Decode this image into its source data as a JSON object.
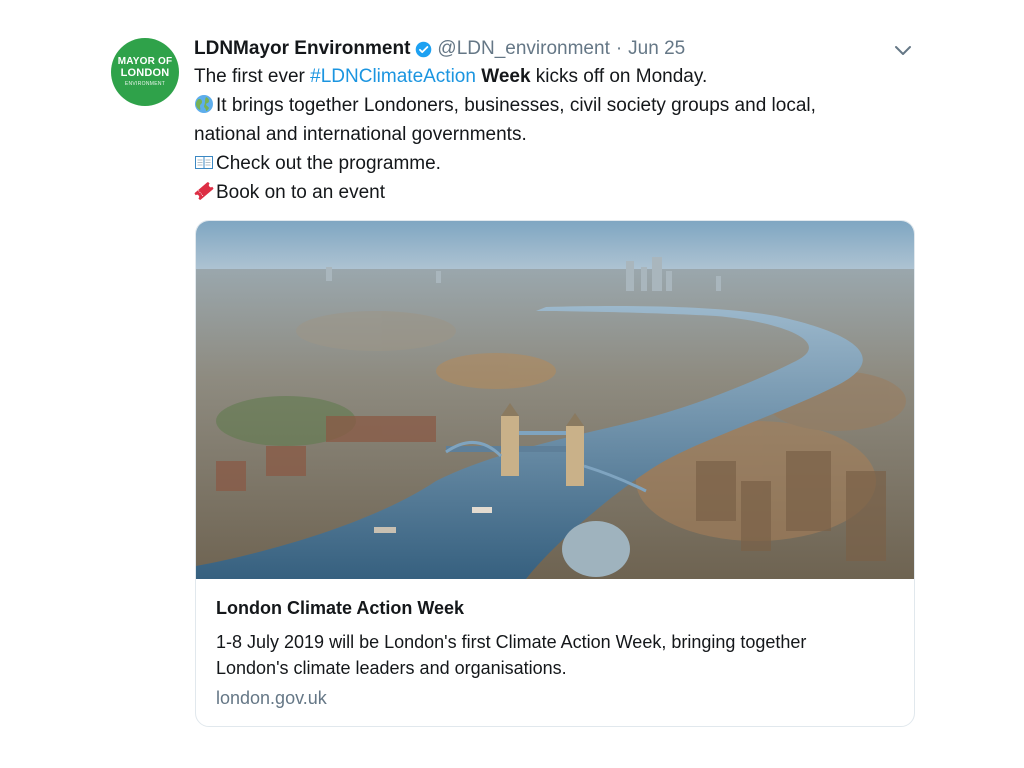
{
  "avatar": {
    "line1": "MAYOR OF",
    "line2": "LONDON",
    "line3": "ENVIRONMENT",
    "color": "#2fa24a"
  },
  "header": {
    "display_name": "LDNMayor Environment",
    "handle": "@LDN_environment",
    "separator": "·",
    "date": "Jun 25",
    "verified_icon": "verified-badge-icon",
    "menu_icon": "chevron-down-icon"
  },
  "tweet": {
    "line1_pre": "The first ever ",
    "hashtag": "#LDNClimateAction",
    "line1_bold": " Week",
    "line1_post": " kicks off on Monday.",
    "line2": "It brings together Londoners, businesses, civil society groups and local,",
    "line3": "national and international governments.",
    "line4": "Check out the programme.",
    "line5": "Book on to an event",
    "emojis": [
      "globe-icon",
      "open-book-icon",
      "ticket-icon"
    ],
    "hashtag_color": "#1b95e0"
  },
  "card": {
    "image_description_icon": "london-aerial-photo",
    "title": "London Climate Action Week",
    "description_line1": "1-8 July 2019 will be London's first Climate Action Week, bringing together",
    "description_line2": "London's climate leaders and organisations.",
    "domain": "london.gov.uk"
  }
}
